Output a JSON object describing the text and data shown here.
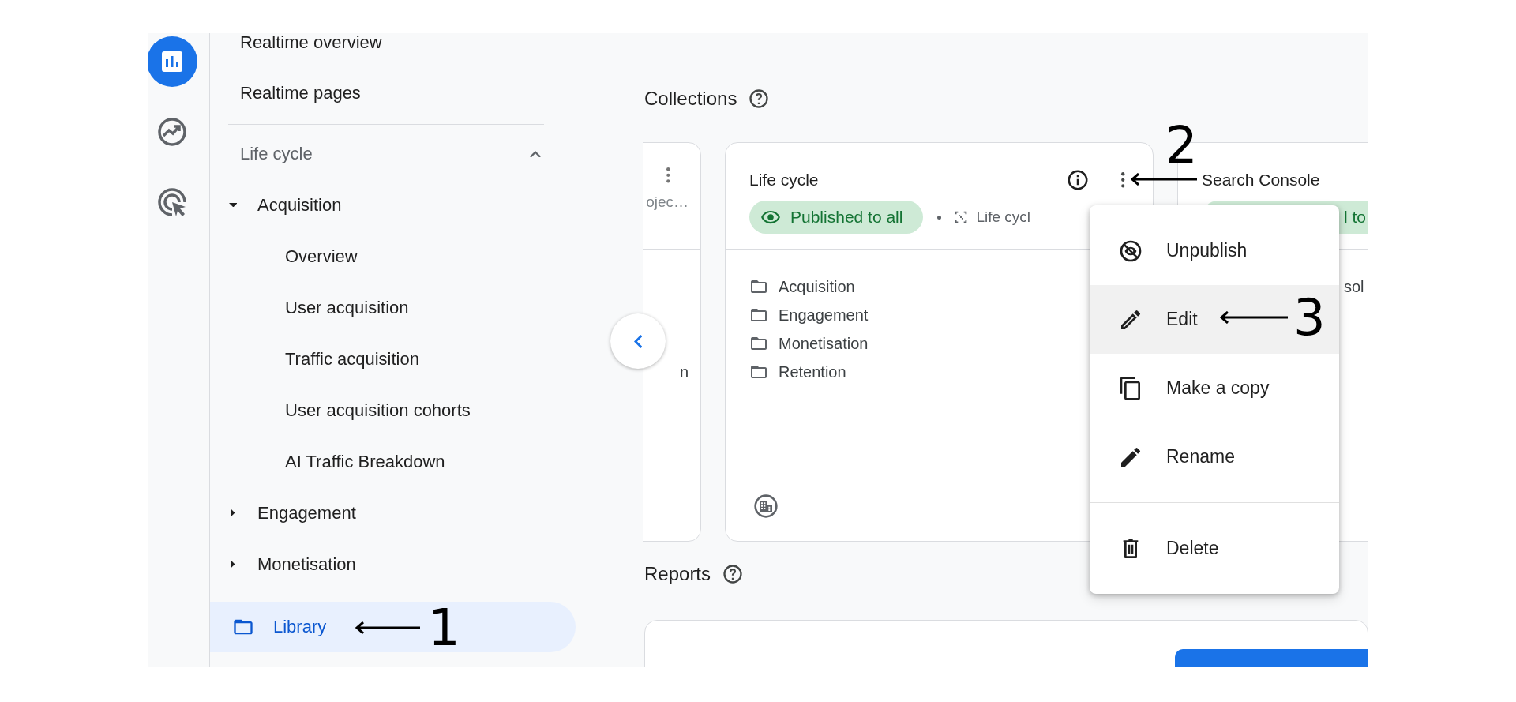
{
  "rail": {
    "items": [
      {
        "kind": "reports",
        "selected": true
      },
      {
        "kind": "explore",
        "selected": false
      },
      {
        "kind": "advertising",
        "selected": false
      }
    ]
  },
  "sidebar": {
    "items": [
      {
        "label": "Realtime overview"
      },
      {
        "label": "Realtime pages"
      }
    ],
    "sections": [
      {
        "label": "Life cycle",
        "expanded": true,
        "children": [
          {
            "label": "Acquisition",
            "expanded": true,
            "children": [
              {
                "label": "Overview"
              },
              {
                "label": "User acquisition"
              },
              {
                "label": "Traffic acquisition"
              },
              {
                "label": "User acquisition cohorts"
              },
              {
                "label": "AI Traffic Breakdown"
              }
            ]
          },
          {
            "label": "Engagement",
            "expanded": false
          },
          {
            "label": "Monetisation",
            "expanded": false
          }
        ]
      }
    ],
    "library": {
      "label": "Library",
      "selected": true
    }
  },
  "collections": {
    "title": "Collections",
    "cards": [
      {
        "kind": "cut-left",
        "subtitle": "ojec…",
        "lines": [
          "n"
        ]
      },
      {
        "kind": "full",
        "title": "Life cycle",
        "status": "Published to all",
        "link": "Life cycl",
        "lines": [
          "Acquisition",
          "Engagement",
          "Monetisation",
          "Retention"
        ]
      },
      {
        "kind": "cut-right",
        "title": "Search Console",
        "status": "l to",
        "lines": [
          "sol"
        ]
      }
    ]
  },
  "menu": {
    "items": [
      {
        "kind": "unpublish",
        "label": "Unpublish",
        "highlighted": false
      },
      {
        "kind": "edit",
        "label": "Edit",
        "highlighted": true
      },
      {
        "kind": "copy",
        "label": "Make a copy",
        "highlighted": false
      },
      {
        "kind": "rename",
        "label": "Rename",
        "highlighted": false
      },
      {
        "kind": "divider"
      },
      {
        "kind": "delete",
        "label": "Delete",
        "highlighted": false
      }
    ]
  },
  "reports": {
    "title": "Reports"
  },
  "annotations": [
    {
      "number": "1"
    },
    {
      "number": "2"
    },
    {
      "number": "3"
    }
  ]
}
